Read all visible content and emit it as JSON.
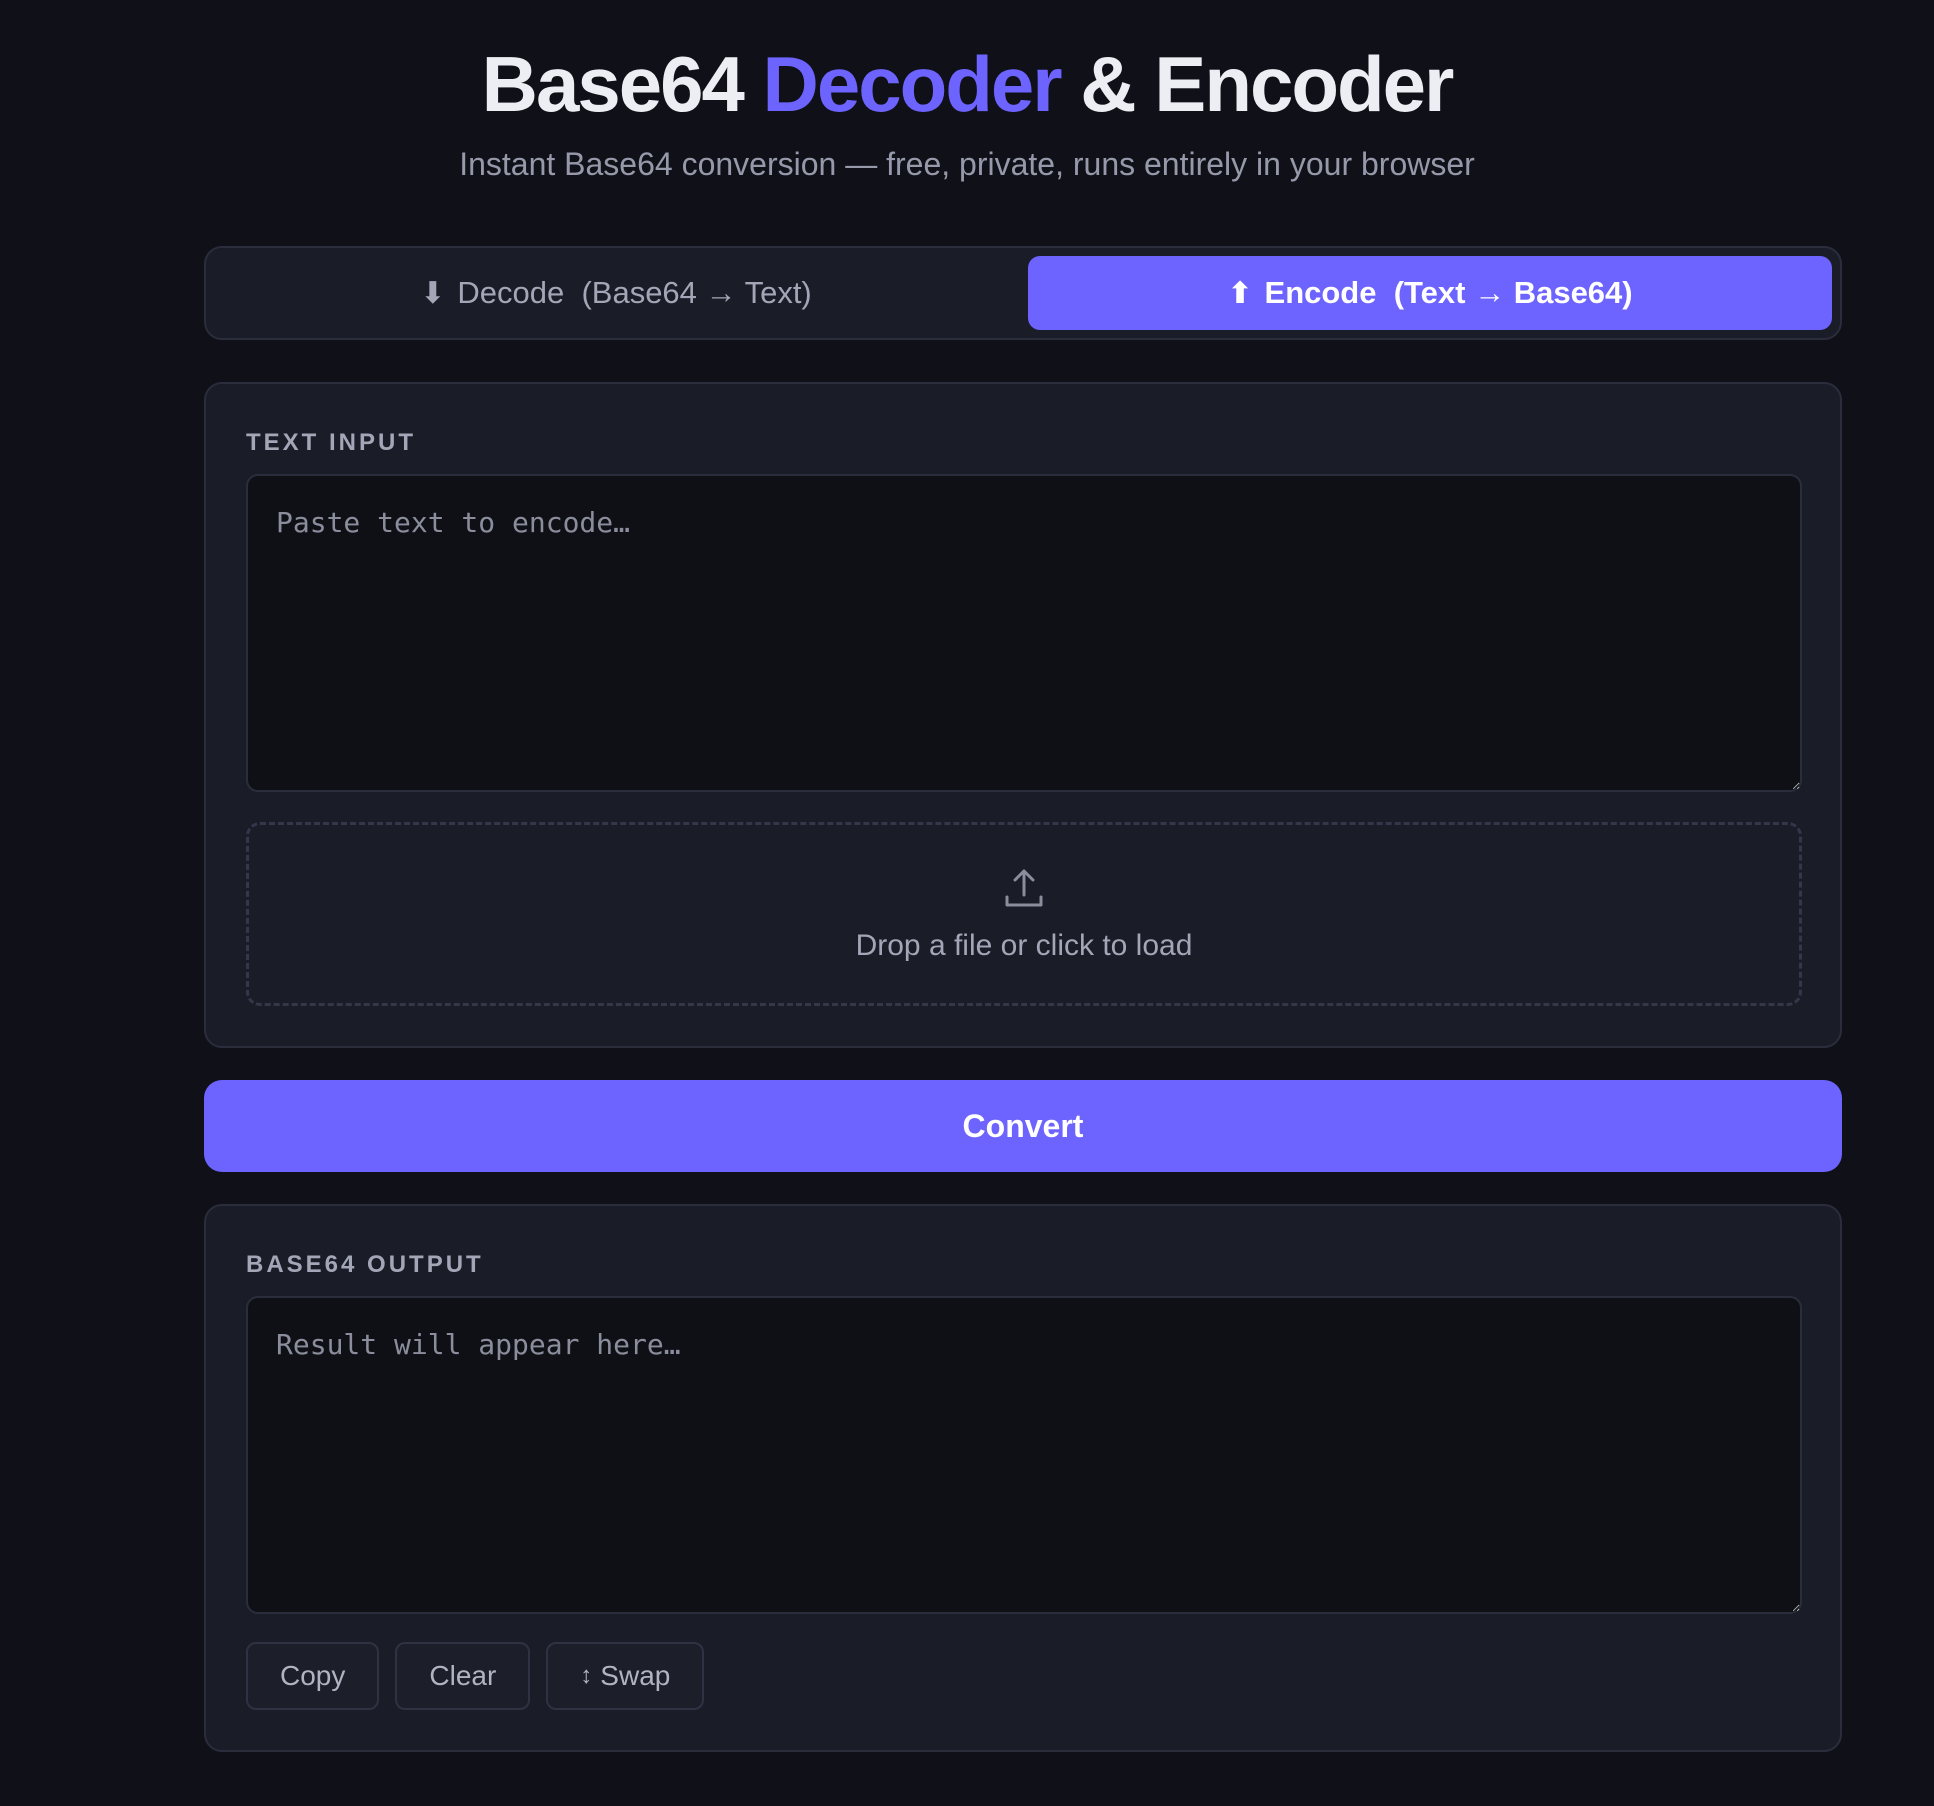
{
  "header": {
    "title_part1": "Base64 ",
    "title_accent": "Decoder",
    "title_part2": " & Encoder",
    "subtitle": "Instant Base64 conversion — free, private, runs entirely in your browser"
  },
  "mode_tabs": [
    {
      "icon": "⬇",
      "icon_name": "arrow-down-icon",
      "label": "Decode  (Base64 → Text)",
      "active": false
    },
    {
      "icon": "⬆",
      "icon_name": "arrow-up-icon",
      "label": "Encode  (Text → Base64)",
      "active": true
    }
  ],
  "input_section": {
    "label": "TEXT INPUT",
    "value": "",
    "placeholder": "Paste text to encode…",
    "drop_zone_text": "Drop a file or click to load",
    "drop_zone_icon": "upload-icon"
  },
  "convert_button": {
    "label": "Convert"
  },
  "output_section": {
    "label": "BASE64 OUTPUT",
    "value": "",
    "placeholder": "Result will appear here…",
    "actions": {
      "copy_label": "Copy",
      "clear_label": "Clear",
      "swap_icon": "↕",
      "swap_label": "Swap"
    }
  },
  "colors": {
    "background": "#101118",
    "card": "#1a1c27",
    "accent": "#6d63ff",
    "text": "#eceef4",
    "muted": "#a3a6b7"
  }
}
